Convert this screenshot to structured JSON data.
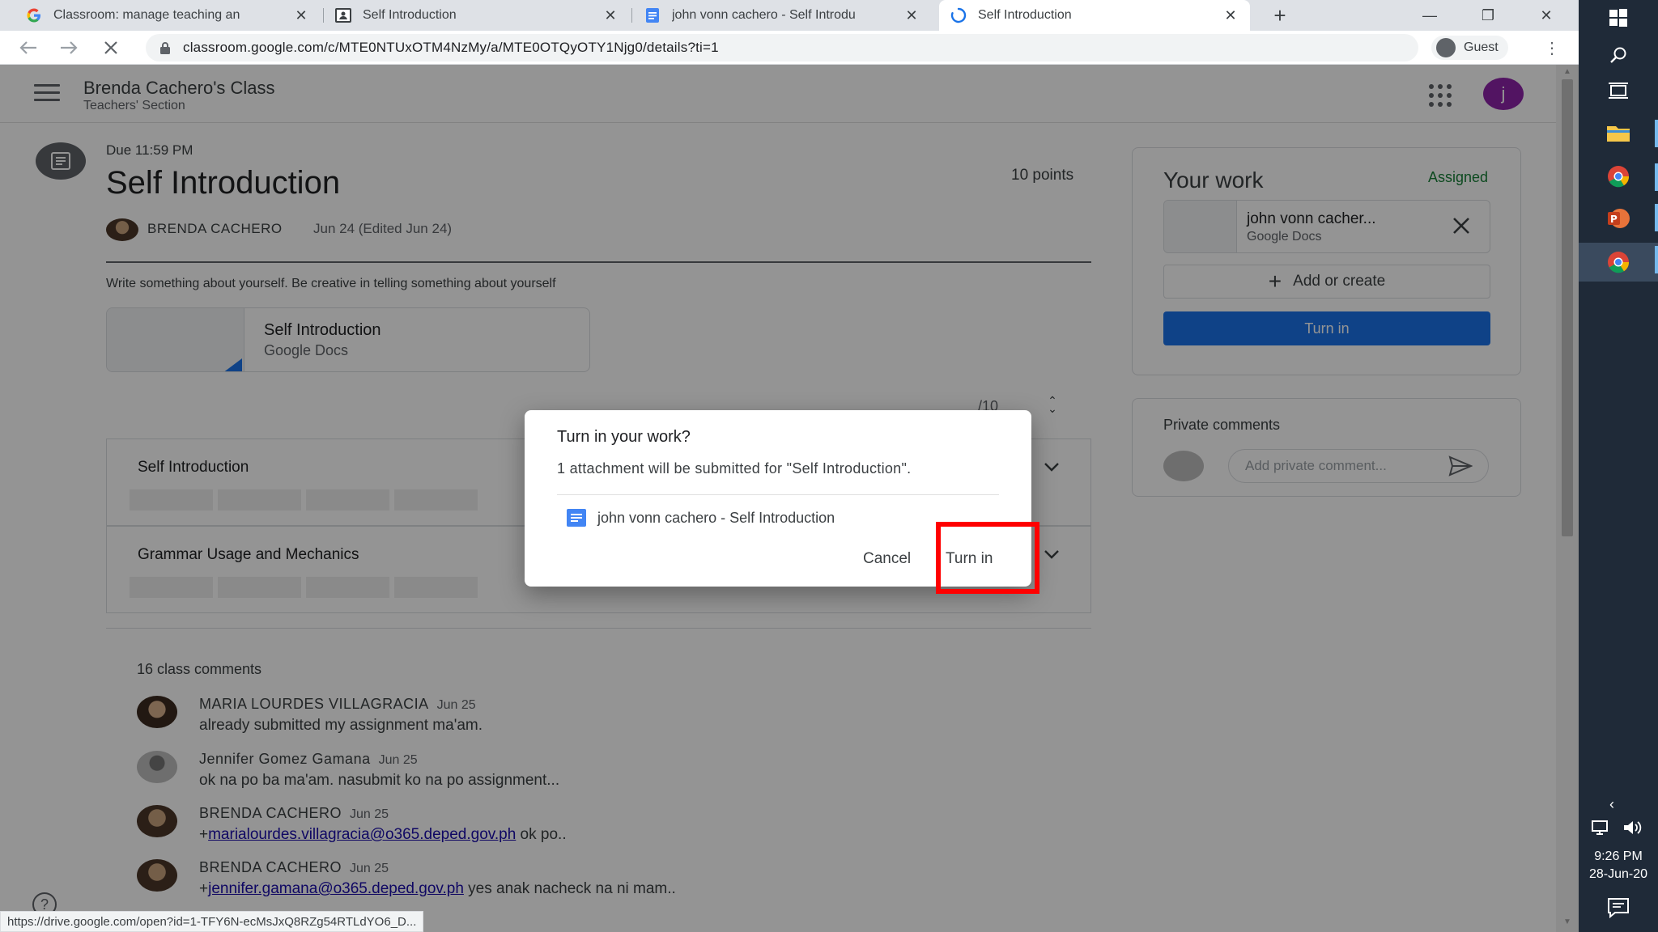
{
  "browser": {
    "tabs": [
      {
        "title": "Classroom: manage teaching an",
        "favicon": "google-g-icon"
      },
      {
        "title": "Self Introduction",
        "favicon": "classroom-icon"
      },
      {
        "title": "john vonn cachero - Self Introdu",
        "favicon": "docs-icon"
      },
      {
        "title": "Self Introduction",
        "favicon": "loading-icon"
      }
    ],
    "url": "classroom.google.com/c/MTE0NTUxOTM4NzMy/a/MTE0OTQyOTY1Njg0/details?ti=1",
    "profile_label": "Guest",
    "status_link": "https://drive.google.com/open?id=1-TFY6N-ecMsJxQ8RZg54RTLdYO6_D..."
  },
  "header": {
    "class_name": "Brenda Cachero's Class",
    "section": "Teachers' Section",
    "avatar_letter": "j"
  },
  "assignment": {
    "due": "Due 11:59 PM",
    "title": "Self Introduction",
    "points": "10 points",
    "author": "BRENDA CACHERO",
    "posted": "Jun 24 (Edited Jun 24)",
    "description": "Write  something about yourself. Be creative in telling something about yourself",
    "attachment": {
      "name": "Self Introduction",
      "type": "Google Docs"
    },
    "score": "/10"
  },
  "rubric": [
    {
      "title": "Self Introduction"
    },
    {
      "title": "Grammar Usage and Mechanics"
    }
  ],
  "comments": {
    "count": "16 class comments",
    "items": [
      {
        "name": "MARIA LOURDES VILLAGRACIA",
        "date": "Jun 25",
        "prefix": "",
        "link": "",
        "text": "already submitted my assignment ma'am."
      },
      {
        "name": "Jennifer Gomez Gamana",
        "date": "Jun 25",
        "prefix": "",
        "link": "",
        "text": "ok na po ba ma'am. nasubmit ko na po assignment..."
      },
      {
        "name": "BRENDA CACHERO",
        "date": "Jun 25",
        "prefix": "+",
        "link": "marialourdes.villagracia@o365.deped.gov.ph",
        "text": " ok po.."
      },
      {
        "name": "BRENDA CACHERO",
        "date": "Jun 25",
        "prefix": "+",
        "link": "jennifer.gamana@o365.deped.gov.ph",
        "text": " yes anak nacheck na ni mam.."
      }
    ]
  },
  "your_work": {
    "title": "Your work",
    "status": "Assigned",
    "file_name": "john vonn cacher...",
    "file_type": "Google Docs",
    "add_label": "Add or create",
    "turn_in_label": "Turn in"
  },
  "private_comments": {
    "title": "Private comments",
    "placeholder": "Add private comment..."
  },
  "dialog": {
    "title": "Turn in your work?",
    "message": "1 attachment will be submitted for \"Self Introduction\".",
    "file": "john vonn cachero - Self Introduction",
    "cancel_label": "Cancel",
    "turn_in_label": "Turn in"
  },
  "taskbar": {
    "time": "9:26 PM",
    "date": "28-Jun-20"
  },
  "colors": {
    "accent": "#1a73e8",
    "highlight": "#ff0000",
    "assigned": "#188038"
  }
}
